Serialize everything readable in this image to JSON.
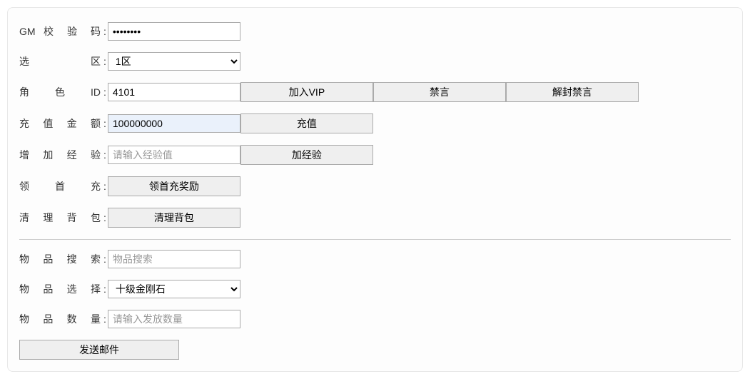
{
  "gmcode": {
    "label": "GM 校 验 码",
    "value": "••••••••"
  },
  "zone": {
    "label": "选区",
    "selected": "1区",
    "options": [
      "1区"
    ]
  },
  "role": {
    "label": "角色ID",
    "value": "4101",
    "vip_btn": "加入VIP",
    "ban_btn": "禁言",
    "unban_btn": "解封禁言"
  },
  "recharge": {
    "label": "充 值 金 额",
    "value": "100000000",
    "btn": "充值"
  },
  "exp": {
    "label": "增 加 经 验",
    "placeholder": "请输入经验值",
    "btn": "加经验"
  },
  "firstcharge": {
    "label": "领 首 充",
    "btn": "领首充奖励"
  },
  "clearbag": {
    "label": "清 理 背 包",
    "btn": "清理背包"
  },
  "itemsearch": {
    "label": "物 品 搜 索",
    "placeholder": "物品搜索"
  },
  "itemselect": {
    "label": "物 品 选 择",
    "selected": "十级金刚石",
    "options": [
      "十级金刚石"
    ]
  },
  "itemqty": {
    "label": "物 品 数 量",
    "placeholder": "请输入发放数量"
  },
  "sendmail": {
    "btn": "发送邮件"
  }
}
